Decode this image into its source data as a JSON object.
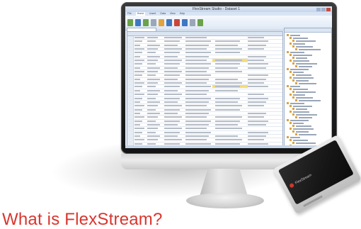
{
  "headline": "What is FlexStream?",
  "app": {
    "window_title": "FlexStream Studio - Dataset 1",
    "menu_tabs": [
      "File",
      "Home",
      "Insert",
      "Data",
      "View",
      "Help"
    ],
    "active_tab": "Home"
  },
  "device": {
    "brand_label": "FlexStream",
    "logo_color": "#c83a2f"
  },
  "colors": {
    "headline": "#d9352d",
    "highlight_cell": "#f6dd74"
  }
}
